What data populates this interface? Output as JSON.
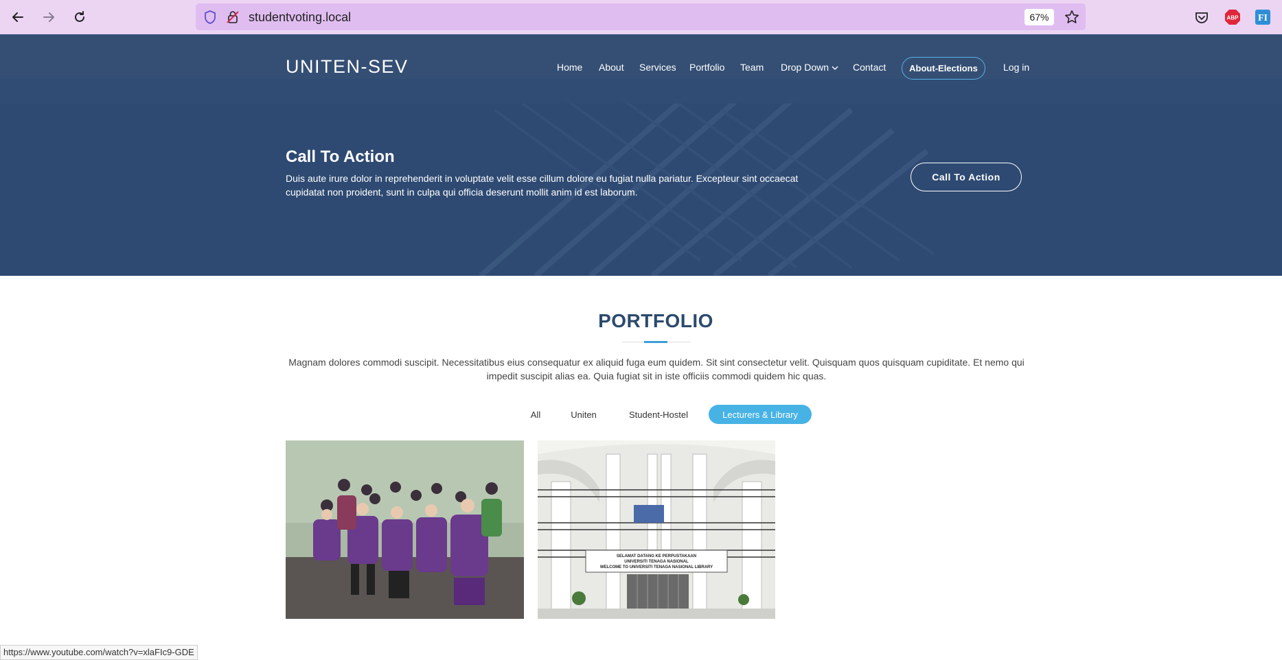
{
  "browser": {
    "url": "studentvoting.local",
    "zoom": "67%",
    "icons": [
      "back-arrow-icon",
      "forward-arrow-icon",
      "reload-icon",
      "shield-icon",
      "lock-slash-icon",
      "star-icon",
      "pocket-icon",
      "abp-icon",
      "extension-icon"
    ],
    "abp_label": "ABP",
    "ext_label": "FI",
    "status_link": "https://www.youtube.com/watch?v=xlaFIc9-GDE"
  },
  "site": {
    "logo": "UNITEN-SEV",
    "nav": {
      "home": "Home",
      "about": "About",
      "services": "Services",
      "portfolio": "Portfolio",
      "team": "Team",
      "dropdown": "Drop Down",
      "contact": "Contact",
      "elections": "About-Elections",
      "login": "Log in"
    }
  },
  "cta": {
    "title": "Call To Action",
    "text": "Duis aute irure dolor in reprehenderit in voluptate velit esse cillum dolore eu fugiat nulla pariatur. Excepteur sint occaecat cupidatat non proident, sunt in culpa qui officia deserunt mollit anim id est laborum.",
    "button": "Call To Action"
  },
  "portfolio": {
    "title": "PORTFOLIO",
    "description": "Magnam dolores commodi suscipit. Necessitatibus eius consequatur ex aliquid fuga eum quidem. Sit sint consectetur velit. Quisquam quos quisquam cupiditate. Et nemo qui impedit suscipit alias ea. Quia fugiat sit in iste officiis commodi quidem hic quas.",
    "filters": [
      "All",
      "Uniten",
      "Student-Hostel",
      "Lecturers & Library"
    ],
    "active_filter": "Lecturers & Library",
    "library_banner": {
      "line1": "SELAMAT DATANG KE PERPUSTAKAAN",
      "line2": "UNIVERSITI TENAGA NASIONAL",
      "line3": "WELCOME TO UNIVERSITI TENAGA NASIONAL LIBRARY"
    }
  },
  "colors": {
    "chrome": "#ebd5f3",
    "urlbar": "#e0bdf0",
    "hero": "#2e4a72",
    "accent": "#47b2e4",
    "title": "#2c4a6e"
  }
}
